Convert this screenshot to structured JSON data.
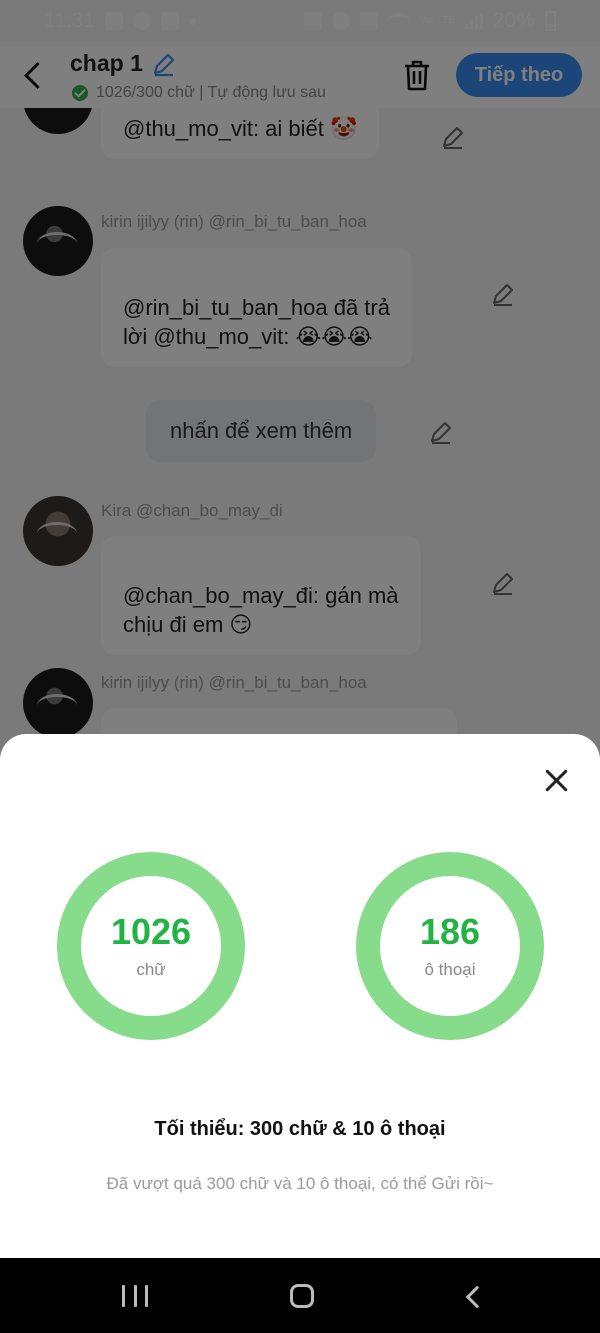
{
  "status_bar": {
    "time": "11:31",
    "battery": "20%",
    "lte": "Vo) LTE"
  },
  "header": {
    "title": "chap 1",
    "subtitle": "1026/300 chữ | Tự động lưu sau",
    "next_button": "Tiếp theo"
  },
  "chat": {
    "messages": [
      {
        "name": "",
        "text": "@thu_mo_vit: ai biết 🤡"
      },
      {
        "name": "kirin ijilyy (rin) @rin_bi_tu_ban_hoa",
        "text": "@rin_bi_tu_ban_hoa đã trả\nlời @thu_mo_vit: 😭😭😭"
      },
      {
        "name": "Kira @chan_bo_may_di",
        "text": "@chan_bo_may_đi: gán mà\nchịu đi em 😏"
      },
      {
        "name": "kirin ijilyy (rin) @rin_bi_tu_ban_hoa",
        "text": ""
      }
    ],
    "see_more": "nhấn để xem thêm"
  },
  "sheet": {
    "words_count": "1026",
    "words_unit": "chữ",
    "dialogue_count": "186",
    "dialogue_unit": "ô thoại",
    "minimum": "Tối thiểu: 300 chữ & 10 ô thoại",
    "note": "Đã vượt quá 300 chữ và 10 ô thoại, có thể Gửi rồi~",
    "ring_color": "#86dc8b",
    "number_color": "#21b443"
  },
  "colors": {
    "accent": "#3b8df0"
  }
}
